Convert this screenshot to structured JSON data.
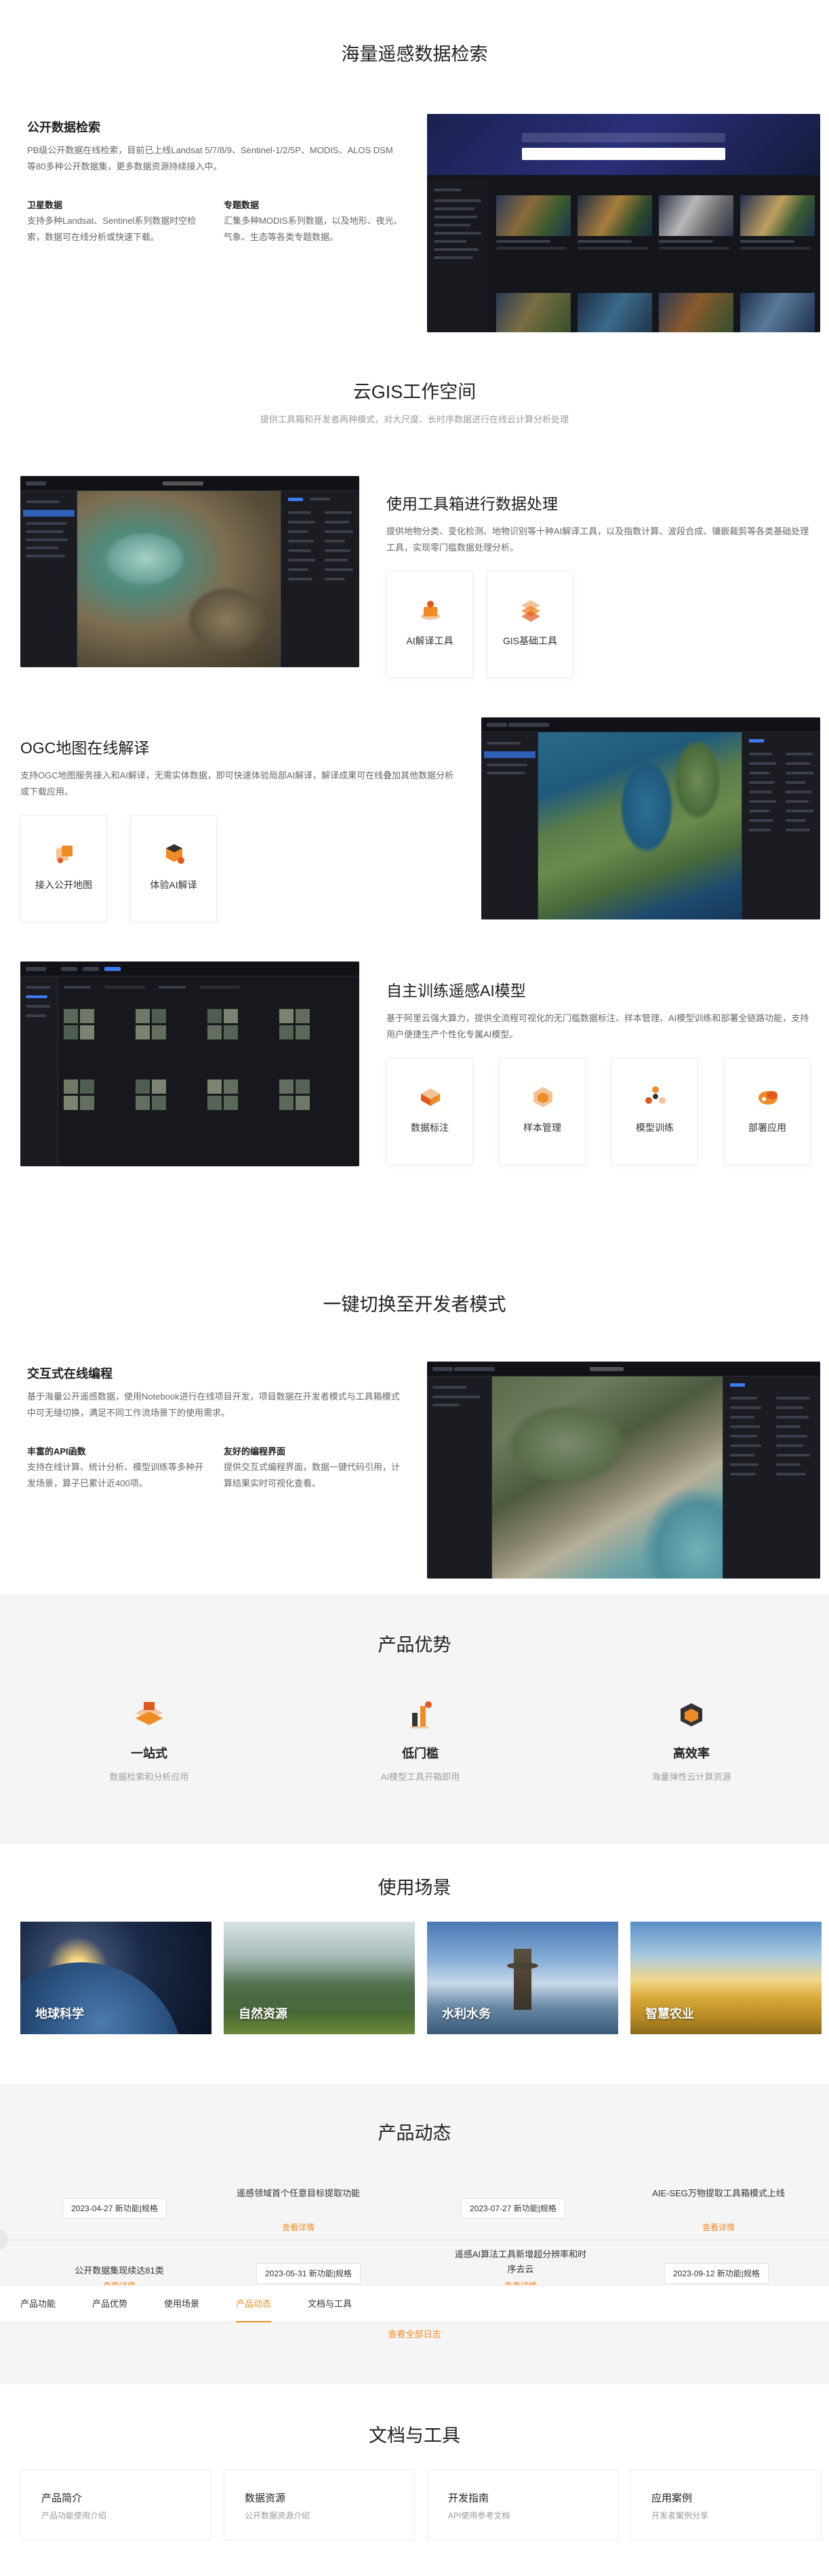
{
  "search_section": {
    "title": "海量遥感数据检索",
    "public_data": {
      "title": "公开数据检索",
      "desc": "PB级公开数据在线检索，目前已上线Landsat 5/7/8/9、Sentinel-1/2/5P、MODIS、ALOS DSM等80多种公开数据集，更多数据资源持续接入中。"
    },
    "satellite": {
      "title": "卫星数据",
      "desc": "支持多种Landsat、Sentinel系列数据时空检索，数据可在线分析或快速下载。"
    },
    "thematic": {
      "title": "专题数据",
      "desc": "汇集多种MODIS系列数据，以及地形、夜光、气象、生态等各类专题数据。"
    }
  },
  "cloud_gis": {
    "title": "云GIS工作空间",
    "subtitle": "提供工具箱和开发者两种模式，对大尺度、长时序数据进行在线云计算分析处理",
    "toolbox": {
      "title": "使用工具箱进行数据处理",
      "desc": "提供地物分类、变化检测、地物识别等十种AI解译工具，以及指数计算、波段合成、镶嵌裁剪等各类基础处理工具，实现零门槛数据处理分析。",
      "cards": [
        {
          "label": "AI解译工具",
          "icon": "ai-tool-icon"
        },
        {
          "label": "GIS基础工具",
          "icon": "gis-tool-icon"
        }
      ]
    },
    "ogc": {
      "title": "OGC地图在线解译",
      "desc": "支持OGC地图服务接入和AI解译，无需实体数据，即可快速体验局部AI解译，解译成果可在线叠加其他数据分析或下载应用。",
      "cards": [
        {
          "label": "接入公开地图",
          "icon": "public-map-icon"
        },
        {
          "label": "体验AI解译",
          "icon": "ai-try-icon"
        }
      ]
    },
    "train": {
      "title": "自主训练遥感AI模型",
      "desc": "基于阿里云强大算力，提供全流程可视化的无门槛数据标注、样本管理、AI模型训练和部署全链路功能，支持用户便捷生产个性化专属AI模型。",
      "cards": [
        {
          "label": "数据标注",
          "icon": "annotate-icon"
        },
        {
          "label": "样本管理",
          "icon": "sample-icon"
        },
        {
          "label": "模型训练",
          "icon": "training-icon"
        },
        {
          "label": "部署应用",
          "icon": "deploy-icon"
        }
      ]
    }
  },
  "dev_mode": {
    "title": "一键切换至开发者模式",
    "notebook": {
      "title": "交互式在线编程",
      "desc": "基于海量公开遥感数据，使用Notebook进行在线项目开发，项目数据在开发者模式与工具箱模式中可无缝切换，满足不同工作流场景下的使用需求。"
    },
    "api": {
      "title": "丰富的API函数",
      "desc": "支持在线计算、统计分析、模型训练等多种开发场景，算子已累计近400项。"
    },
    "ui": {
      "title": "友好的编程界面",
      "desc": "提供交互式编程界面，数据一键代码引用，计算结果实时可视化查看。"
    }
  },
  "advantages": {
    "title": "产品优势",
    "items": [
      {
        "name": "一站式",
        "desc": "数据检索和分析应用",
        "icon": "one-stop-icon"
      },
      {
        "name": "低门槛",
        "desc": "AI模型工具开箱即用",
        "icon": "low-barrier-icon"
      },
      {
        "name": "高效率",
        "desc": "海量弹性云计算资源",
        "icon": "efficiency-icon"
      }
    ]
  },
  "scenes": {
    "title": "使用场景",
    "items": [
      {
        "label": "地球科学"
      },
      {
        "label": "自然资源"
      },
      {
        "label": "水利水务"
      },
      {
        "label": "智慧农业"
      }
    ]
  },
  "news": {
    "title": "产品动态",
    "items": [
      {
        "date": "2023-04-27 新功能|规格",
        "title": "公开数据集现续达81类",
        "link": "查看详情"
      },
      {
        "date": "2023-05-31 新功能|规格",
        "title": "遥感领域首个任意目标提取功能",
        "link": "查看详情"
      },
      {
        "date": "2023-07-27 新功能|规格",
        "title": "遥感AI算法工具新增超分辨率和时序去云",
        "link": "查看详情"
      },
      {
        "date": "2023-09-12 新功能|规格",
        "title": "AIE-SEG万物提取工具箱模式上线",
        "link": "查看详情"
      }
    ],
    "all_log": "查看全部日志"
  },
  "subnav": {
    "items": [
      "产品功能",
      "产品优势",
      "使用场景",
      "产品动态",
      "文档与工具"
    ],
    "active": "产品动态"
  },
  "docs": {
    "title": "文档与工具",
    "items": [
      {
        "title": "产品简介",
        "desc": "产品功能使用介绍"
      },
      {
        "title": "数据资源",
        "desc": "公开数据资源介绍"
      },
      {
        "title": "开发指南",
        "desc": "API使用参考文档"
      },
      {
        "title": "应用案例",
        "desc": "开发者案例分享"
      }
    ]
  },
  "colors": {
    "accent": "#f08c26",
    "dark_ui": "#1b1d24",
    "section_gray": "#f5f5f5"
  }
}
